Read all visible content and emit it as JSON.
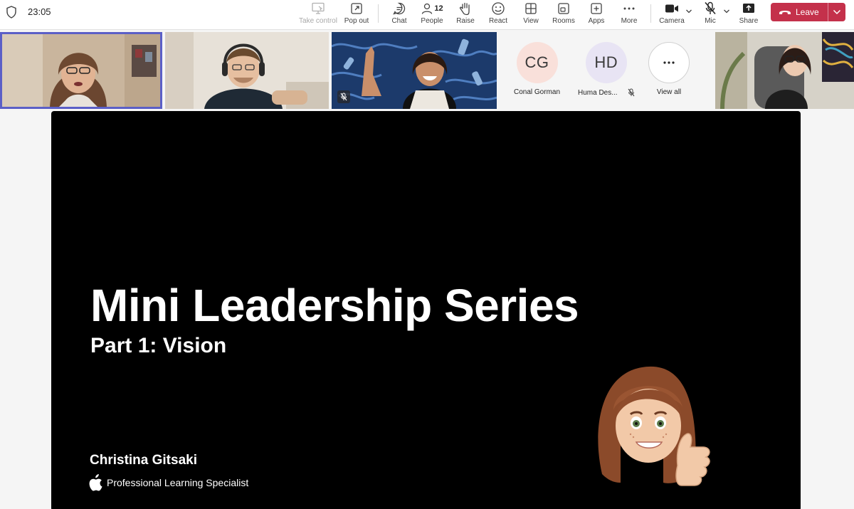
{
  "status": {
    "time": "23:05"
  },
  "toolbar": {
    "take_control": "Take control",
    "pop_out": "Pop out",
    "chat": "Chat",
    "people": "People",
    "people_count": "12",
    "raise": "Raise",
    "react": "React",
    "view": "View",
    "rooms": "Rooms",
    "apps": "Apps",
    "more": "More",
    "camera": "Camera",
    "mic": "Mic",
    "share": "Share",
    "leave": "Leave"
  },
  "participants": {
    "avatars": [
      {
        "initials": "CG",
        "name": "Conal Gorman",
        "color": "#f9e0da"
      },
      {
        "initials": "HD",
        "name": "Huma Des...",
        "color": "#e8e4f4"
      }
    ],
    "view_all": "View all"
  },
  "slide": {
    "title": "Mini Leadership Series",
    "subtitle": "Part 1: Vision",
    "presenter": "Christina Gitsaki",
    "role": "Professional Learning Specialist"
  },
  "colors": {
    "accent": "#5b5fc7",
    "leave": "#c4314b"
  }
}
